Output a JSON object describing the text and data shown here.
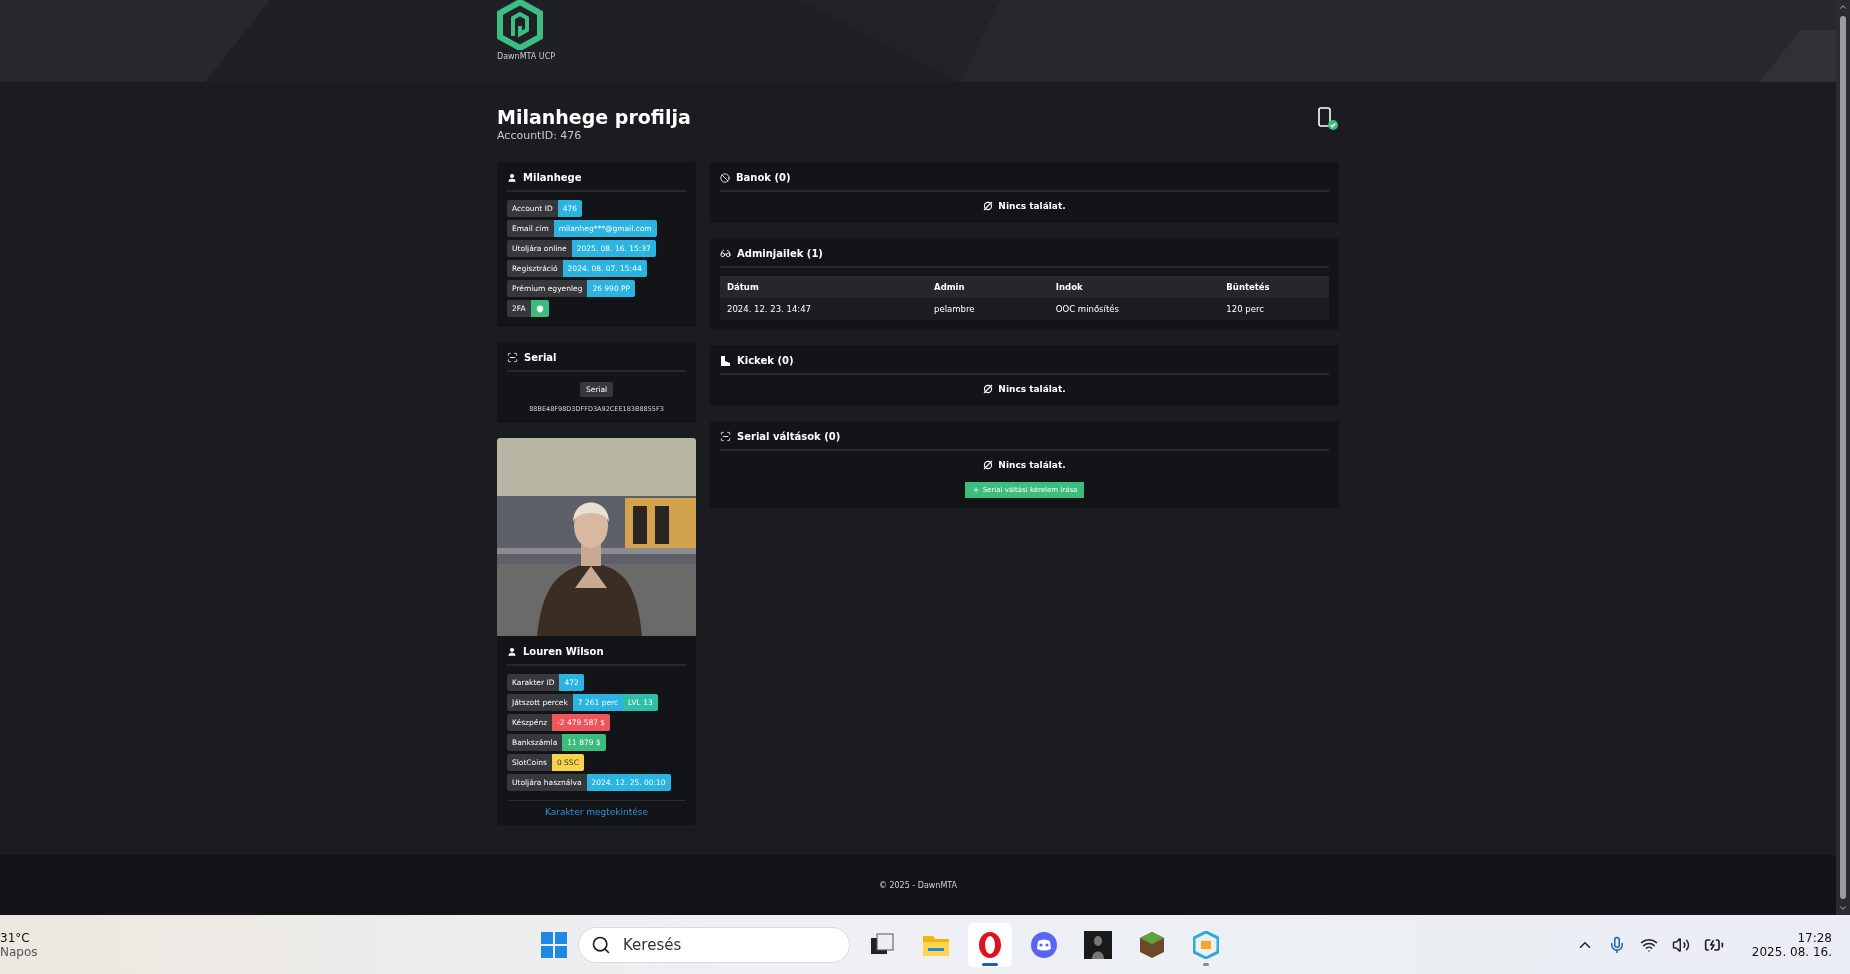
{
  "header": {
    "brand": "DawnMTA UCP"
  },
  "profile": {
    "title": "Milanhege profilja",
    "account_id": "AccountID: 476",
    "twofa_verified": true
  },
  "account_card": {
    "title": "Milanhege",
    "fields": [
      {
        "label": "Account ID",
        "kind": "text",
        "values": [
          {
            "text": "476",
            "color": "#2bb3e2"
          }
        ]
      },
      {
        "label": "Email cím",
        "kind": "text",
        "values": [
          {
            "text": "milanheg***@gmail.com",
            "color": "#2bb3e2"
          }
        ]
      },
      {
        "label": "Utoljára online",
        "kind": "text",
        "values": [
          {
            "text": "2025. 08. 16. 15:37",
            "color": "#2bb3e2"
          }
        ]
      },
      {
        "label": "Regisztráció",
        "kind": "text",
        "values": [
          {
            "text": "2024. 08. 07. 15:44",
            "color": "#2bb3e2"
          }
        ]
      },
      {
        "label": "Prémium egyenleg",
        "kind": "text",
        "values": [
          {
            "text": "26 990 PP",
            "color": "#2bb3e2"
          }
        ]
      },
      {
        "label": "2FA",
        "kind": "shield",
        "values": [
          {
            "color": "#3cbc7d"
          }
        ]
      }
    ]
  },
  "serial_card": {
    "title": "Serial",
    "badge": "Serial",
    "value": "88BE48F98D3DFFD3A92CEE183B8855F3"
  },
  "character_card": {
    "title": "Louren Wilson",
    "fields": [
      {
        "label": "Karakter ID",
        "kind": "text",
        "values": [
          {
            "text": "472",
            "color": "#2bb3e2"
          }
        ]
      },
      {
        "label": "Játszott percek",
        "kind": "text",
        "values": [
          {
            "text": "7 261 perc",
            "color": "#2bb3e2"
          },
          {
            "text": "LVL 13",
            "color": "#2fbfa6"
          }
        ]
      },
      {
        "label": "Készpénz",
        "kind": "text",
        "values": [
          {
            "text": "-2 479 587 $",
            "color": "#f0555b"
          }
        ]
      },
      {
        "label": "Bankszámla",
        "kind": "text",
        "values": [
          {
            "text": "11 879 $",
            "color": "#3cbc7d"
          }
        ]
      },
      {
        "label": "SlotCoins",
        "kind": "text",
        "values": [
          {
            "text": "0 SSC",
            "color": "#f6d24e"
          }
        ]
      },
      {
        "label": "Utoljára használva",
        "kind": "text",
        "values": [
          {
            "text": "2024. 12. 25. 00:10",
            "color": "#2bb3e2"
          }
        ]
      }
    ],
    "link": "Karakter megtekintése"
  },
  "panels": [
    {
      "title": "Banok (0)",
      "kind": "empty",
      "empty_text": "Nincs találat."
    },
    {
      "title": "Adminjailek (1)",
      "kind": "table",
      "table": {
        "columns": [
          "Dátum",
          "Admin",
          "Indok",
          "Büntetés"
        ],
        "rows": [
          [
            "2024. 12. 23. 14:47",
            "pelambre",
            "OOC minősítés",
            "120 perc"
          ]
        ]
      }
    },
    {
      "title": "Kickek (0)",
      "kind": "empty",
      "empty_text": "Nincs találat."
    },
    {
      "title": "Serial váltások (0)",
      "kind": "empty",
      "empty_text": "Nincs találat.",
      "button": "Serial váltási kérelem írása"
    }
  ],
  "footer": "© 2025 - DawnMTA",
  "taskbar": {
    "weather": {
      "temp": "31°C",
      "condition": "Napos"
    },
    "search_placeholder": "Keresés",
    "apps": [
      {
        "selected": false,
        "running": false
      },
      {
        "selected": false,
        "running": false
      },
      {
        "selected": true,
        "running": true
      },
      {
        "selected": false,
        "running": false
      },
      {
        "selected": false,
        "running": false
      },
      {
        "selected": false,
        "running": false
      },
      {
        "selected": false,
        "running": true
      }
    ],
    "time": "17:28",
    "date": "2025. 08. 16."
  }
}
